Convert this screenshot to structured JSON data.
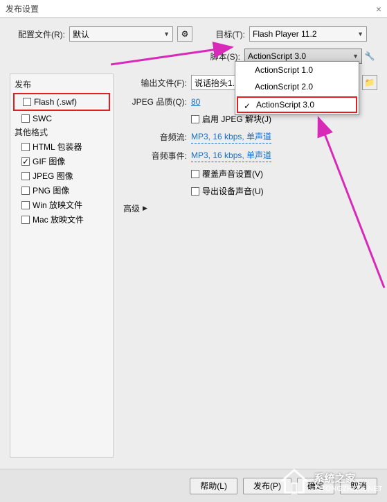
{
  "title": "发布设置",
  "profile": {
    "label": "配置文件(R):",
    "value": "默认"
  },
  "target": {
    "label": "目标(T):",
    "value": "Flash Player 11.2"
  },
  "script": {
    "label": "脚本(S):",
    "value": "ActionScript 3.0"
  },
  "script_options": {
    "items": [
      "ActionScript 1.0",
      "ActionScript 2.0",
      "ActionScript 3.0"
    ],
    "selected_index": 2
  },
  "sidebar": {
    "publish_header": "发布",
    "flash": "Flash (.swf)",
    "swc": "SWC",
    "other_header": "其他格式",
    "html": "HTML 包装器",
    "gif": "GIF 图像",
    "jpeg": "JPEG 图像",
    "png": "PNG 图像",
    "win": "Win 放映文件",
    "mac": "Mac 放映文件"
  },
  "content": {
    "output_label": "输出文件(F):",
    "output_value": "说话抬头1.swf",
    "jpeg_quality_label": "JPEG 品质(Q):",
    "jpeg_quality_value": "80",
    "enable_jpeg_deblock": "启用 JPEG 解块(J)",
    "audio_stream_label": "音频流:",
    "audio_stream_value": "MP3, 16 kbps, 单声道",
    "audio_event_label": "音频事件:",
    "audio_event_value": "MP3, 16 kbps, 单声道",
    "override_sound": "覆盖声音设置(V)",
    "export_device_sound": "导出设备声音(U)",
    "advanced": "高级"
  },
  "buttons": {
    "help": "帮助(L)",
    "publish": "发布(P)",
    "ok": "确定",
    "cancel": "取消"
  },
  "watermark": {
    "main": "系统之家",
    "sub": "XITONGZHIJIA.NET"
  }
}
